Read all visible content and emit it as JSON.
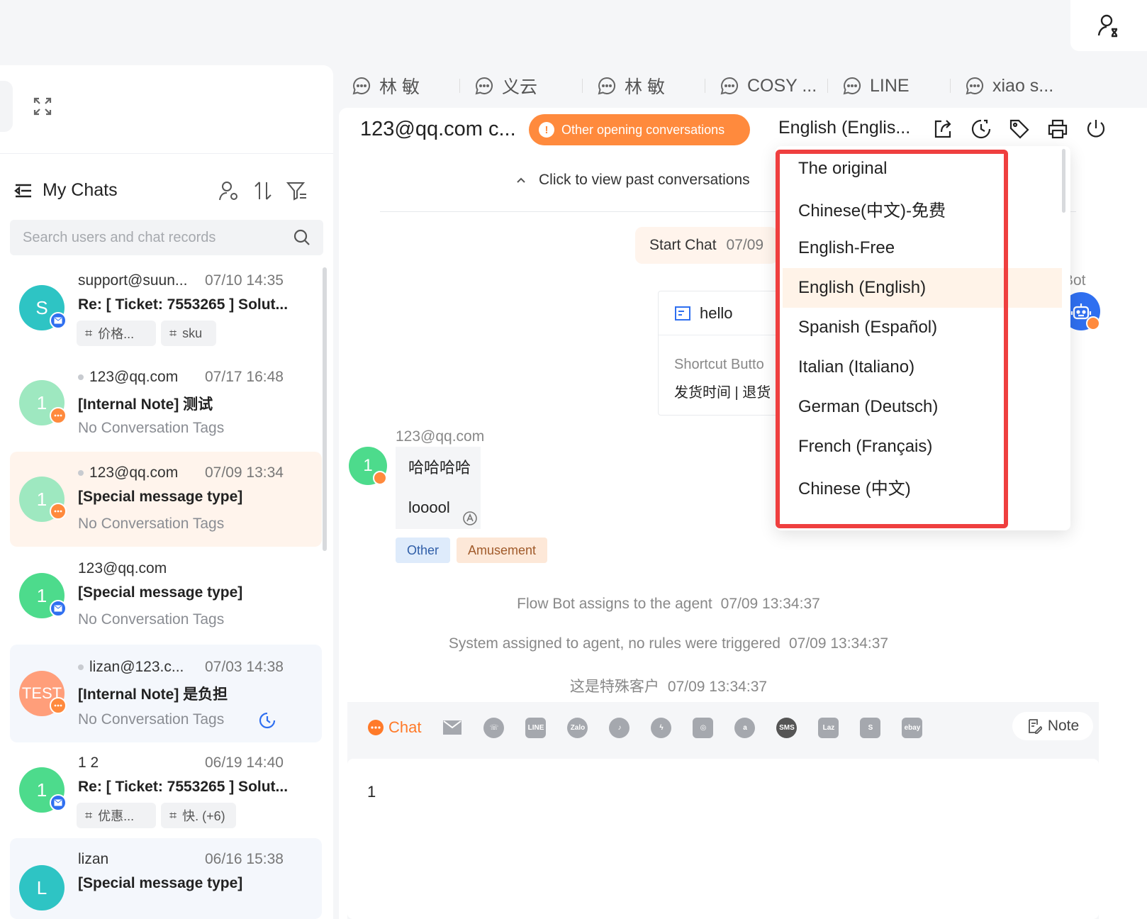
{
  "sidebar": {
    "title": "My Chats",
    "search_placeholder": "Search users and chat records",
    "conversations": [
      {
        "avatar": "S",
        "name": "support@suun...",
        "time": "07/10 14:35",
        "subject": "Re: [ Ticket: 7553265 ] Solut...",
        "tags": [
          "价格...",
          "sku"
        ],
        "channel": "mail-icon"
      },
      {
        "avatar": "1",
        "name": "123@qq.com",
        "time": "07/17 16:48",
        "subject": "[Internal Note] 测试",
        "tagline": "No Conversation Tags",
        "channel": "chat-icon"
      },
      {
        "avatar": "1",
        "name": "123@qq.com",
        "time": "07/09 13:34",
        "subject": "[Special message type]",
        "tagline": "No Conversation Tags",
        "channel": "chat-icon"
      },
      {
        "avatar": "1",
        "name": "123@qq.com",
        "time": "",
        "subject": "[Special message type]",
        "tagline": "No Conversation Tags",
        "channel": "mail-icon"
      },
      {
        "avatar": "TEST",
        "name": "lizan@123.c...",
        "time": "07/03 14:38",
        "subject": "[Internal Note] 是负担",
        "tagline": "No Conversation Tags",
        "channel": "chat-icon"
      },
      {
        "avatar": "1",
        "name": "1 2",
        "time": "06/19 14:40",
        "subject": "Re: [ Ticket: 7553265 ] Solut...",
        "tags": [
          "优惠...",
          "快. (+6)"
        ],
        "channel": "mail-icon"
      },
      {
        "avatar": "L",
        "name": "lizan",
        "time": "06/16 15:38",
        "subject": "[Special message type]"
      }
    ]
  },
  "tabs": [
    "林 敏",
    "义云",
    "林 敏",
    "COSY ...",
    "LINE",
    "xiao s..."
  ],
  "header": {
    "title": "123@qq.com c...",
    "alert": "Other opening conversations",
    "language": "English (Englis..."
  },
  "chat": {
    "past_link": "Click to view past conversations",
    "start_chat": "Start Chat",
    "start_time": "07/09",
    "card_title": "hello",
    "card_line1": "Shortcut Butto",
    "card_line2": "发货时间 | 退货",
    "bot_label": "Bot",
    "user_name": "123@qq.com",
    "msg1": "哈哈哈哈",
    "msg2": "looool",
    "tag_other": "Other",
    "tag_amusement": "Amusement",
    "sys1": "Flow Bot assigns to the agent",
    "sys1_time": "07/09 13:34:37",
    "sys2": "System assigned to agent, no rules were triggered",
    "sys2_time": "07/09 13:34:37",
    "sys3": "这是特殊客户",
    "sys3_time": "07/09 13:34:37"
  },
  "compose": {
    "chat_label": "Chat",
    "note_label": "Note",
    "text": "1"
  },
  "dropdown": {
    "items": [
      "The original",
      "Chinese(中文)-免费",
      "English-Free",
      "English (English)",
      "Spanish (Español)",
      "Italian (Italiano)",
      "German (Deutsch)",
      "French (Français)",
      "Chinese (中文)"
    ],
    "selected": "English (English)"
  },
  "colors": {
    "accent": "#ff8a3d",
    "brand_blue": "#2f6ff0",
    "highlight": "#ef3f3f"
  }
}
